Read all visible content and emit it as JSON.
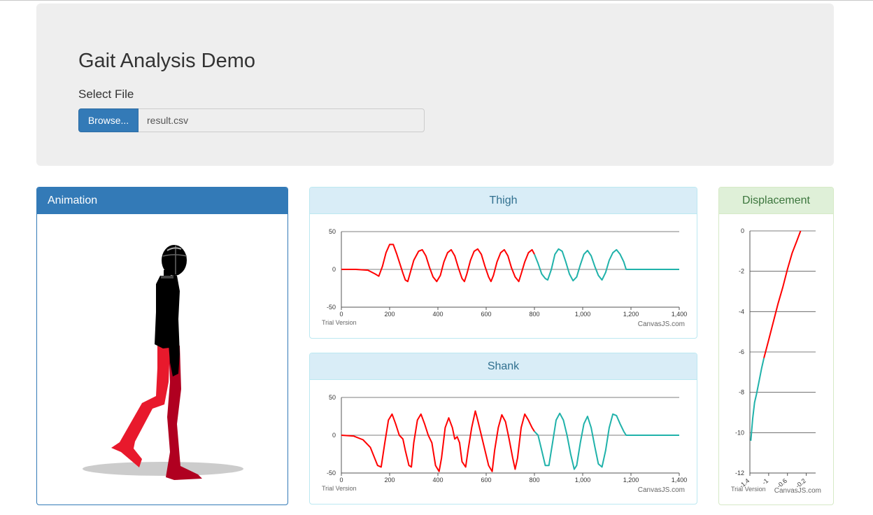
{
  "header": {
    "title": "Gait Analysis Demo",
    "select_label": "Select File",
    "browse_label": "Browse...",
    "file_name": "result.csv"
  },
  "panels": {
    "animation": "Animation",
    "thigh": "Thigh",
    "shank": "Shank",
    "displacement": "Displacement"
  },
  "chart_badges": {
    "trial": "Trial Version",
    "credit": "CanvasJS.com"
  },
  "colors": {
    "primary": "#337ab7",
    "series_red": "#ff0000",
    "series_teal": "#20b2aa"
  },
  "chart_data": [
    {
      "name": "thigh",
      "type": "line",
      "title": "Thigh",
      "xlim": [
        0,
        1400
      ],
      "ylim": [
        -50,
        50
      ],
      "xticks": [
        0,
        200,
        400,
        600,
        800,
        1000,
        1200,
        1400
      ],
      "xtick_labels": [
        "0",
        "200",
        "400",
        "600",
        "800",
        "1,000",
        "1,200",
        "1,400"
      ],
      "yticks": [
        -50,
        0,
        50
      ],
      "series": [
        {
          "color": "#ff0000",
          "points": [
            [
              0,
              0
            ],
            [
              60,
              0
            ],
            [
              110,
              -1
            ],
            [
              140,
              -6
            ],
            [
              155,
              -9
            ],
            [
              170,
              4
            ],
            [
              185,
              22
            ],
            [
              200,
              33
            ],
            [
              215,
              33
            ],
            [
              230,
              20
            ],
            [
              245,
              5
            ],
            [
              255,
              -5
            ],
            [
              265,
              -14
            ],
            [
              275,
              -16
            ],
            [
              285,
              -5
            ],
            [
              300,
              12
            ],
            [
              320,
              24
            ],
            [
              335,
              26
            ],
            [
              350,
              18
            ],
            [
              365,
              3
            ],
            [
              380,
              -10
            ],
            [
              395,
              -16
            ],
            [
              410,
              -8
            ],
            [
              425,
              10
            ],
            [
              440,
              22
            ],
            [
              455,
              26
            ],
            [
              470,
              18
            ],
            [
              485,
              2
            ],
            [
              500,
              -12
            ],
            [
              510,
              -16
            ],
            [
              520,
              -6
            ],
            [
              535,
              12
            ],
            [
              550,
              24
            ],
            [
              565,
              27
            ],
            [
              580,
              20
            ],
            [
              595,
              4
            ],
            [
              610,
              -10
            ],
            [
              620,
              -16
            ],
            [
              630,
              -8
            ],
            [
              645,
              10
            ],
            [
              660,
              22
            ],
            [
              675,
              26
            ],
            [
              690,
              18
            ],
            [
              705,
              2
            ],
            [
              720,
              -10
            ],
            [
              735,
              -16
            ],
            [
              745,
              -6
            ],
            [
              760,
              10
            ],
            [
              775,
              22
            ],
            [
              790,
              26
            ],
            [
              800,
              20
            ]
          ]
        },
        {
          "color": "#20b2aa",
          "points": [
            [
              800,
              20
            ],
            [
              815,
              8
            ],
            [
              830,
              -6
            ],
            [
              845,
              -12
            ],
            [
              855,
              -14
            ],
            [
              870,
              0
            ],
            [
              885,
              20
            ],
            [
              900,
              27
            ],
            [
              915,
              24
            ],
            [
              930,
              10
            ],
            [
              945,
              -6
            ],
            [
              960,
              -15
            ],
            [
              975,
              -10
            ],
            [
              990,
              6
            ],
            [
              1005,
              20
            ],
            [
              1020,
              25
            ],
            [
              1035,
              18
            ],
            [
              1050,
              4
            ],
            [
              1065,
              -8
            ],
            [
              1080,
              -14
            ],
            [
              1095,
              -4
            ],
            [
              1110,
              12
            ],
            [
              1125,
              22
            ],
            [
              1140,
              26
            ],
            [
              1155,
              20
            ],
            [
              1170,
              10
            ],
            [
              1180,
              0
            ],
            [
              1400,
              0
            ]
          ]
        }
      ]
    },
    {
      "name": "shank",
      "type": "line",
      "title": "Shank",
      "xlim": [
        0,
        1400
      ],
      "ylim": [
        -50,
        50
      ],
      "xticks": [
        0,
        200,
        400,
        600,
        800,
        1000,
        1200,
        1400
      ],
      "xtick_labels": [
        "0",
        "200",
        "400",
        "600",
        "800",
        "1,000",
        "1,200",
        "1,400"
      ],
      "yticks": [
        -50,
        0,
        50
      ],
      "series": [
        {
          "color": "#ff0000",
          "points": [
            [
              0,
              0
            ],
            [
              50,
              -1
            ],
            [
              90,
              -6
            ],
            [
              120,
              -16
            ],
            [
              150,
              -40
            ],
            [
              165,
              -42
            ],
            [
              180,
              -10
            ],
            [
              195,
              20
            ],
            [
              210,
              28
            ],
            [
              225,
              15
            ],
            [
              240,
              0
            ],
            [
              255,
              -5
            ],
            [
              265,
              -20
            ],
            [
              280,
              -40
            ],
            [
              290,
              -42
            ],
            [
              300,
              -10
            ],
            [
              315,
              20
            ],
            [
              330,
              28
            ],
            [
              345,
              15
            ],
            [
              360,
              0
            ],
            [
              375,
              -10
            ],
            [
              390,
              -40
            ],
            [
              405,
              -48
            ],
            [
              415,
              -30
            ],
            [
              430,
              10
            ],
            [
              445,
              23
            ],
            [
              460,
              10
            ],
            [
              470,
              -5
            ],
            [
              480,
              -2
            ],
            [
              490,
              -10
            ],
            [
              500,
              -35
            ],
            [
              515,
              -42
            ],
            [
              525,
              -20
            ],
            [
              540,
              10
            ],
            [
              555,
              32
            ],
            [
              565,
              20
            ],
            [
              580,
              0
            ],
            [
              595,
              -20
            ],
            [
              610,
              -40
            ],
            [
              625,
              -48
            ],
            [
              635,
              -20
            ],
            [
              650,
              10
            ],
            [
              665,
              27
            ],
            [
              680,
              18
            ],
            [
              695,
              -5
            ],
            [
              710,
              -30
            ],
            [
              720,
              -45
            ],
            [
              730,
              -30
            ],
            [
              745,
              10
            ],
            [
              760,
              28
            ],
            [
              775,
              20
            ],
            [
              790,
              10
            ],
            [
              800,
              5
            ]
          ]
        },
        {
          "color": "#20b2aa",
          "points": [
            [
              800,
              5
            ],
            [
              815,
              0
            ],
            [
              830,
              -20
            ],
            [
              845,
              -40
            ],
            [
              860,
              -40
            ],
            [
              875,
              -10
            ],
            [
              890,
              20
            ],
            [
              905,
              29
            ],
            [
              920,
              20
            ],
            [
              935,
              0
            ],
            [
              950,
              -25
            ],
            [
              965,
              -45
            ],
            [
              975,
              -40
            ],
            [
              990,
              -10
            ],
            [
              1005,
              15
            ],
            [
              1020,
              25
            ],
            [
              1035,
              10
            ],
            [
              1050,
              -15
            ],
            [
              1065,
              -38
            ],
            [
              1080,
              -42
            ],
            [
              1095,
              -20
            ],
            [
              1110,
              10
            ],
            [
              1125,
              28
            ],
            [
              1140,
              26
            ],
            [
              1155,
              15
            ],
            [
              1170,
              5
            ],
            [
              1180,
              0
            ],
            [
              1400,
              0
            ]
          ]
        }
      ]
    },
    {
      "name": "displacement",
      "type": "line",
      "title": "Displacement",
      "xlim": [
        -1.4,
        0
      ],
      "ylim": [
        -12,
        0
      ],
      "xticks": [
        -1.4,
        -1.0,
        -0.6,
        -0.2
      ],
      "xtick_labels": [
        "-1.4",
        "-1",
        "-0.6",
        "-0.2"
      ],
      "yticks": [
        0,
        -2,
        -4,
        -6,
        -8,
        -10,
        -12
      ],
      "series": [
        {
          "color": "#20b2aa",
          "points": [
            [
              -1.38,
              -10.4
            ],
            [
              -1.34,
              -9.3
            ],
            [
              -1.3,
              -8.5
            ],
            [
              -1.26,
              -8.1
            ],
            [
              -1.2,
              -7.4
            ],
            [
              -1.15,
              -6.8
            ],
            [
              -1.1,
              -6.3
            ]
          ]
        },
        {
          "color": "#ff0000",
          "points": [
            [
              -1.1,
              -6.3
            ],
            [
              -1.0,
              -5.4
            ],
            [
              -0.9,
              -4.5
            ],
            [
              -0.8,
              -3.6
            ],
            [
              -0.7,
              -2.8
            ],
            [
              -0.6,
              -1.9
            ],
            [
              -0.5,
              -1.1
            ],
            [
              -0.4,
              -0.5
            ],
            [
              -0.32,
              0
            ]
          ]
        }
      ]
    }
  ]
}
